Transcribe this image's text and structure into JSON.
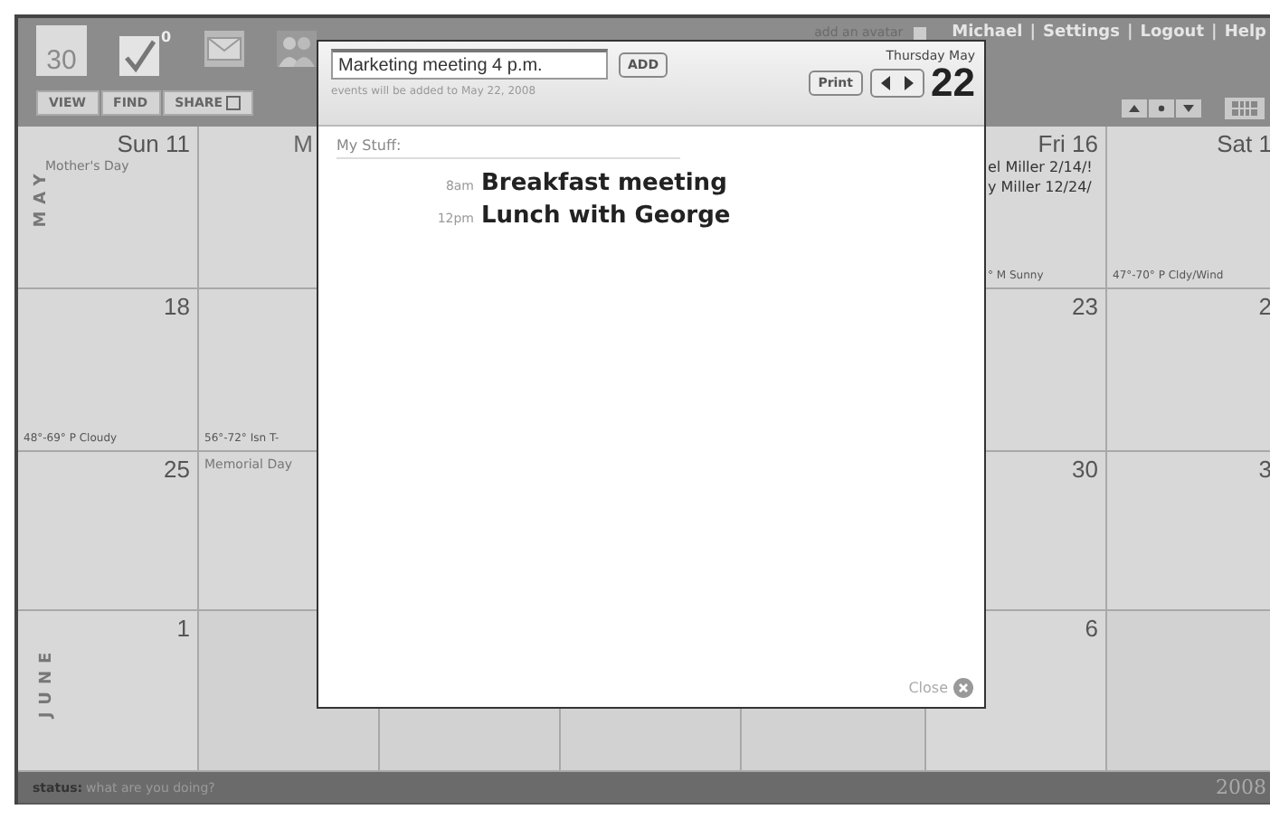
{
  "header": {
    "logo": "30",
    "todo_badge": "0",
    "nav_buttons": [
      "VIEW",
      "FIND",
      "SHARE"
    ],
    "avatar_link": "add an avatar",
    "user_links": [
      "Michael",
      "Settings",
      "Logout",
      "Help"
    ],
    "separator": "|"
  },
  "calendar": {
    "weeks": [
      {
        "month": "MAY",
        "days": [
          {
            "date": "Sun 11",
            "events": [
              "Mother's Day"
            ]
          },
          {
            "date": "M"
          },
          {
            "date": "Fri 16",
            "events": [
              "el Miller 2/14/!",
              "y Miller 12/24/"
            ],
            "weather": "° M Sunny"
          },
          {
            "date": "Sat 1",
            "weather": "47°-70° P Cldy/Wind"
          }
        ]
      },
      {
        "days": [
          {
            "date": "18",
            "weather": "48°-69° P Cloudy"
          },
          {
            "weather": "56°-72° Isn T-"
          },
          {
            "date": "23"
          },
          {
            "date": "2"
          }
        ]
      },
      {
        "days": [
          {
            "date": "25"
          },
          {
            "events": [
              "Memorial Day"
            ]
          },
          {
            "date": "30"
          },
          {
            "date": "3"
          }
        ]
      },
      {
        "month": "JUNE",
        "days": [
          {
            "date": "1"
          },
          {
            "kind": "empty"
          },
          {
            "kind": "empty"
          },
          {
            "kind": "empty"
          },
          {
            "kind": "empty"
          },
          {
            "date": "6"
          },
          {
            "kind": "empty"
          }
        ]
      }
    ]
  },
  "popup": {
    "input_value": "Marketing meeting 4 p.m.",
    "add_button": "ADD",
    "hint": "events will be added to May 22, 2008",
    "weekday_month": "Thursday May",
    "print_button": "Print",
    "day": "22",
    "section": "My Stuff:",
    "events": [
      {
        "time": "8am",
        "title": "Breakfast meeting"
      },
      {
        "time": "12pm",
        "title": "Lunch with George"
      }
    ],
    "close": "Close"
  },
  "status_bar": {
    "label": "status:",
    "placeholder": "what are you doing?",
    "year": "2008"
  }
}
